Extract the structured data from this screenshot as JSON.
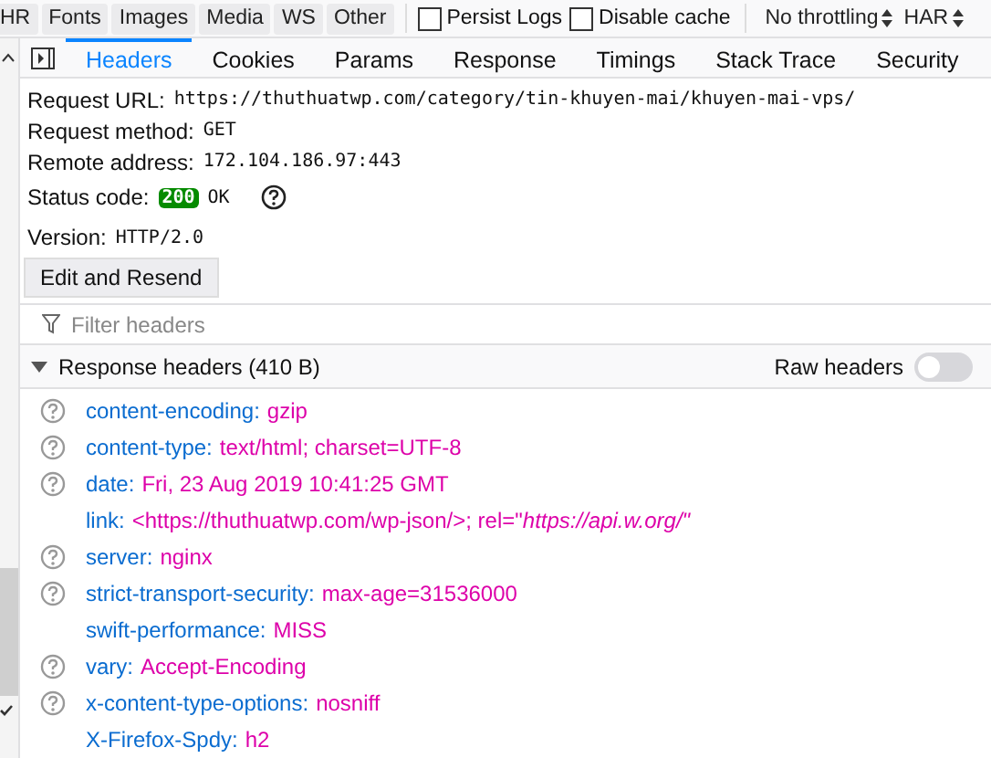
{
  "toolbar": {
    "filters": [
      "HR",
      "Fonts",
      "Images",
      "Media",
      "WS",
      "Other"
    ],
    "checkboxes": [
      {
        "label": "Persist Logs",
        "checked": false
      },
      {
        "label": "Disable cache",
        "checked": false
      }
    ],
    "selects": [
      "No throttling",
      "HAR"
    ]
  },
  "tabs": [
    {
      "label": "Headers",
      "selected": true
    },
    {
      "label": "Cookies",
      "selected": false
    },
    {
      "label": "Params",
      "selected": false
    },
    {
      "label": "Response",
      "selected": false
    },
    {
      "label": "Timings",
      "selected": false
    },
    {
      "label": "Stack Trace",
      "selected": false
    },
    {
      "label": "Security",
      "selected": false
    }
  ],
  "summary": [
    {
      "label": "Request URL:",
      "value": "https://thuthuatwp.com/category/tin-khuyen-mai/khuyen-mai-vps/"
    },
    {
      "label": "Request method:",
      "value": "GET"
    },
    {
      "label": "Remote address:",
      "value": "172.104.186.97:443"
    }
  ],
  "status": {
    "label": "Status code:",
    "code": "200",
    "text": "OK"
  },
  "version": {
    "label": "Version:",
    "value": "HTTP/2.0"
  },
  "resend_button": "Edit and Resend",
  "filter": {
    "placeholder": "Filter headers"
  },
  "section": {
    "title": "Response headers (410 B)",
    "expanded": true,
    "raw_label": "Raw headers",
    "raw_on": false
  },
  "headers": [
    {
      "name": "content-encoding:",
      "value": "gzip",
      "help": true
    },
    {
      "name": "content-type:",
      "value": "text/html; charset=UTF-8",
      "help": true
    },
    {
      "name": "date:",
      "value": "Fri, 23 Aug 2019 10:41:25 GMT",
      "help": true
    },
    {
      "name": "link:",
      "value": "<https://thuthuatwp.com/wp-json/>; rel=\"*https://api.w.org/\"*",
      "help": false
    },
    {
      "name": "server:",
      "value": "nginx",
      "help": true
    },
    {
      "name": "strict-transport-security:",
      "value": "max-age=31536000",
      "help": true
    },
    {
      "name": "swift-performance:",
      "value": "MISS",
      "help": false
    },
    {
      "name": "vary:",
      "value": "Accept-Encoding",
      "help": true
    },
    {
      "name": "x-content-type-options:",
      "value": "nosniff",
      "help": true
    },
    {
      "name": "X-Firefox-Spdy:",
      "value": "h2",
      "help": false
    }
  ]
}
